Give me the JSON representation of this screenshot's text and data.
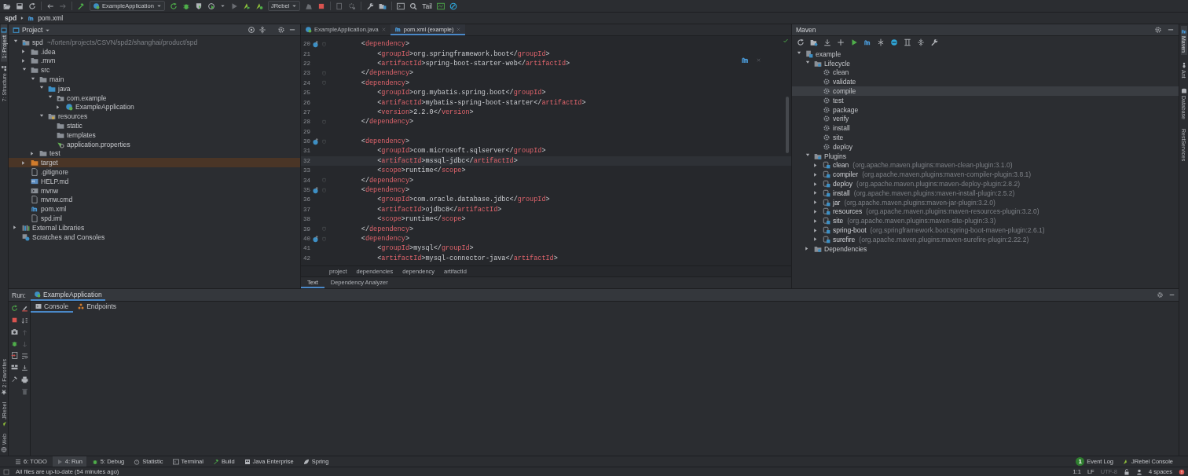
{
  "toolbar": {
    "run_config": "ExampleApplication",
    "jrebel_config": "JRebel",
    "tail": "Tail"
  },
  "breadcrumb": [
    "spd",
    "pom.xml"
  ],
  "left_stripe": {
    "top": [
      {
        "label": "1: Project",
        "selected": true
      },
      {
        "label": "7: Structure",
        "selected": false
      }
    ],
    "bottom": [
      {
        "label": "2: Favorites"
      },
      {
        "label": "JRebel"
      },
      {
        "label": "Web"
      }
    ]
  },
  "project": {
    "title": "Project",
    "tree": [
      {
        "label": "spd",
        "hint": "~/forten/projects/CSVN/spd2/shanghai/product/spd",
        "kind": "module",
        "expanded": true,
        "children": [
          {
            "label": ".idea",
            "kind": "folder",
            "expanded": false
          },
          {
            "label": ".mvn",
            "kind": "folder",
            "expanded": false
          },
          {
            "label": "src",
            "kind": "folder",
            "expanded": true,
            "children": [
              {
                "label": "main",
                "kind": "folder",
                "expanded": true,
                "children": [
                  {
                    "label": "java",
                    "kind": "source",
                    "expanded": true,
                    "children": [
                      {
                        "label": "com.example",
                        "kind": "package",
                        "expanded": true,
                        "children": [
                          {
                            "label": "ExampleApplication",
                            "kind": "class",
                            "expanded": false
                          }
                        ]
                      }
                    ]
                  },
                  {
                    "label": "resources",
                    "kind": "resources",
                    "expanded": true,
                    "children": [
                      {
                        "label": "static",
                        "kind": "folder"
                      },
                      {
                        "label": "templates",
                        "kind": "folder"
                      },
                      {
                        "label": "application.properties",
                        "kind": "properties"
                      }
                    ]
                  }
                ]
              },
              {
                "label": "test",
                "kind": "folder",
                "expanded": false
              }
            ]
          },
          {
            "label": "target",
            "kind": "excluded",
            "expanded": false
          },
          {
            "label": ".gitignore",
            "kind": "file"
          },
          {
            "label": "HELP.md",
            "kind": "markdown"
          },
          {
            "label": "mvnw",
            "kind": "script"
          },
          {
            "label": "mvnw.cmd",
            "kind": "file"
          },
          {
            "label": "pom.xml",
            "kind": "maven"
          },
          {
            "label": "spd.iml",
            "kind": "file"
          }
        ]
      },
      {
        "label": "External Libraries",
        "kind": "libraries",
        "expanded": false
      },
      {
        "label": "Scratches and Consoles",
        "kind": "scratches"
      }
    ]
  },
  "editor": {
    "tabs": [
      {
        "label": "ExampleApplication.java",
        "kind": "class",
        "selected": false
      },
      {
        "label": "pom.xml (example)",
        "kind": "maven",
        "selected": true
      }
    ],
    "lines": [
      {
        "num": "20",
        "code": "        <dependency>",
        "marker": true,
        "fold": true
      },
      {
        "num": "21",
        "code": "            <groupId>org.springframework.boot</groupId>"
      },
      {
        "num": "22",
        "code": "            <artifactId>spring-boot-starter-web</artifactId>"
      },
      {
        "num": "23",
        "code": "        </dependency>",
        "fold": true
      },
      {
        "num": "24",
        "code": "        <dependency>",
        "fold": true
      },
      {
        "num": "25",
        "code": "            <groupId>org.mybatis.spring.boot</groupId>"
      },
      {
        "num": "26",
        "code": "            <artifactId>mybatis-spring-boot-starter</artifactId>"
      },
      {
        "num": "27",
        "code": "            <version>2.2.0</version>"
      },
      {
        "num": "28",
        "code": "        </dependency>",
        "fold": true
      },
      {
        "num": "29"
      },
      {
        "num": "30",
        "code": "        <dependency>",
        "marker": true,
        "fold": true
      },
      {
        "num": "31",
        "code": "            <groupId>com.microsoft.sqlserver</groupId>"
      },
      {
        "num": "32",
        "code": "            <artifactId>mssql-jdbc</artifactId>",
        "current": true
      },
      {
        "num": "33",
        "code": "            <scope>runtime</scope>"
      },
      {
        "num": "34",
        "code": "        </dependency>",
        "fold": true
      },
      {
        "num": "35",
        "code": "        <dependency>",
        "marker": true,
        "fold": true
      },
      {
        "num": "36",
        "code": "            <groupId>com.oracle.database.jdbc</groupId>"
      },
      {
        "num": "37",
        "code": "            <artifactId>ojdbc8</artifactId>"
      },
      {
        "num": "38",
        "code": "            <scope>runtime</scope>"
      },
      {
        "num": "39",
        "code": "        </dependency>",
        "fold": true
      },
      {
        "num": "40",
        "code": "        <dependency>",
        "marker": true,
        "fold": true
      },
      {
        "num": "41",
        "code": "            <groupId>mysql</groupId>"
      },
      {
        "num": "42",
        "code": "            <artifactId>mysql-connector-java</artifactId>"
      }
    ],
    "breadcrumb": [
      "project",
      "dependencies",
      "dependency",
      "artifactId"
    ],
    "bottom_tabs": [
      {
        "label": "Text",
        "selected": true
      },
      {
        "label": "Dependency Analyzer",
        "selected": false
      }
    ]
  },
  "maven": {
    "title": "Maven",
    "tree": [
      {
        "label": "example",
        "kind": "project",
        "expanded": true,
        "children": [
          {
            "label": "Lifecycle",
            "kind": "group",
            "expanded": true,
            "children": [
              {
                "label": "clean",
                "kind": "goal",
                "selected": false
              },
              {
                "label": "validate",
                "kind": "goal",
                "selected": false
              },
              {
                "label": "compile",
                "kind": "goal",
                "selected": true
              },
              {
                "label": "test",
                "kind": "goal",
                "selected": false
              },
              {
                "label": "package",
                "kind": "goal",
                "selected": false
              },
              {
                "label": "verify",
                "kind": "goal",
                "selected": false
              },
              {
                "label": "install",
                "kind": "goal",
                "selected": false
              },
              {
                "label": "site",
                "kind": "goal",
                "selected": false
              },
              {
                "label": "deploy",
                "kind": "goal",
                "selected": false
              }
            ]
          },
          {
            "label": "Plugins",
            "kind": "group",
            "expanded": true,
            "children": [
              {
                "label": "clean",
                "detail": "(org.apache.maven.plugins:maven-clean-plugin:3.1.0)",
                "kind": "plugin",
                "expanded": false
              },
              {
                "label": "compiler",
                "detail": "(org.apache.maven.plugins:maven-compiler-plugin:3.8.1)",
                "kind": "plugin",
                "expanded": false
              },
              {
                "label": "deploy",
                "detail": "(org.apache.maven.plugins:maven-deploy-plugin:2.8.2)",
                "kind": "plugin",
                "expanded": false
              },
              {
                "label": "install",
                "detail": "(org.apache.maven.plugins:maven-install-plugin:2.5.2)",
                "kind": "plugin",
                "expanded": false
              },
              {
                "label": "jar",
                "detail": "(org.apache.maven.plugins:maven-jar-plugin:3.2.0)",
                "kind": "plugin",
                "expanded": false
              },
              {
                "label": "resources",
                "detail": "(org.apache.maven.plugins:maven-resources-plugin:3.2.0)",
                "kind": "plugin",
                "expanded": false
              },
              {
                "label": "site",
                "detail": "(org.apache.maven.plugins:maven-site-plugin:3.3)",
                "kind": "plugin",
                "expanded": false
              },
              {
                "label": "spring-boot",
                "detail": "(org.springframework.boot:spring-boot-maven-plugin:2.6.1)",
                "kind": "plugin",
                "expanded": false
              },
              {
                "label": "surefire",
                "detail": "(org.apache.maven.plugins:maven-surefire-plugin:2.22.2)",
                "kind": "plugin",
                "expanded": false
              }
            ]
          },
          {
            "label": "Dependencies",
            "kind": "group",
            "expanded": false
          }
        ]
      }
    ]
  },
  "right_stripe": [
    {
      "label": "Maven",
      "selected": true
    },
    {
      "label": "Ant",
      "selected": false
    },
    {
      "label": "Database",
      "selected": false
    },
    {
      "label": "RestServices",
      "selected": false
    }
  ],
  "run": {
    "title": "Run:",
    "tab": "ExampleApplication",
    "subtabs": [
      {
        "label": "Console",
        "selected": true
      },
      {
        "label": "Endpoints",
        "selected": false
      }
    ]
  },
  "tool_windows": [
    {
      "label": "6: TODO",
      "selected": false
    },
    {
      "label": "4: Run",
      "selected": true
    },
    {
      "label": "5: Debug",
      "selected": false
    },
    {
      "label": "Statistic",
      "selected": false
    },
    {
      "label": "Terminal",
      "selected": false
    },
    {
      "label": "Build",
      "selected": false
    },
    {
      "label": "Java Enterprise",
      "selected": false
    },
    {
      "label": "Spring",
      "selected": false
    }
  ],
  "event_log": {
    "label": "Event Log",
    "badge": "1"
  },
  "jrebel_console": "JRebel Console",
  "status_bar": {
    "message": "All files are up-to-date (54 minutes ago)",
    "items": [
      {
        "label": "1:1",
        "disabled": false
      },
      {
        "label": "LF",
        "disabled": false
      },
      {
        "label": "UTF-8",
        "disabled": true
      }
    ],
    "indent": "4 spaces"
  }
}
